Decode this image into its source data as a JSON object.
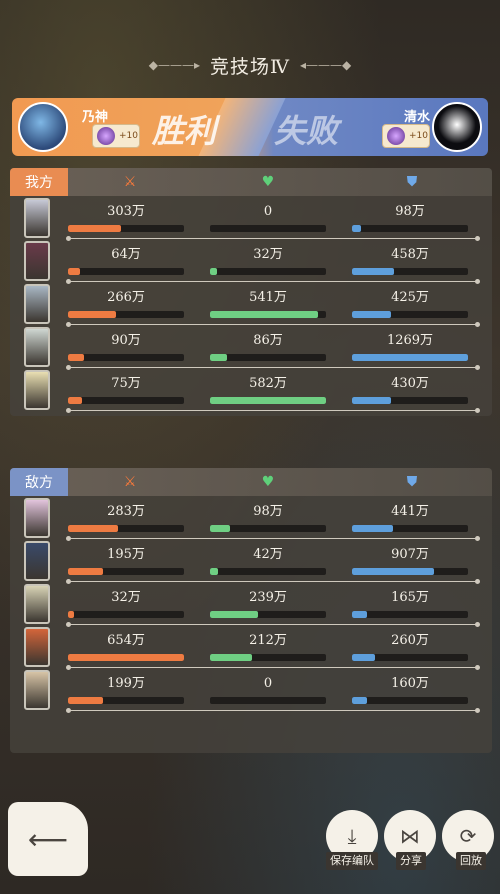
{
  "header": {
    "title": "竞技场Ⅳ"
  },
  "banner": {
    "player_left": "乃神",
    "player_right": "清水",
    "result_win": "胜利",
    "result_lose": "失败",
    "pet_left_level": "+10",
    "pet_right_level": "+10"
  },
  "ours": {
    "label": "我方",
    "rows": [
      {
        "atk": "303万",
        "atk_pct": 0.46,
        "heal": "0",
        "heal_pct": 0.0,
        "def": "98万",
        "def_pct": 0.08
      },
      {
        "atk": "64万",
        "atk_pct": 0.1,
        "heal": "32万",
        "heal_pct": 0.06,
        "def": "458万",
        "def_pct": 0.36
      },
      {
        "atk": "266万",
        "atk_pct": 0.41,
        "heal": "541万",
        "heal_pct": 0.93,
        "def": "425万",
        "def_pct": 0.34
      },
      {
        "atk": "90万",
        "atk_pct": 0.14,
        "heal": "86万",
        "heal_pct": 0.15,
        "def": "1269万",
        "def_pct": 1.0
      },
      {
        "atk": "75万",
        "atk_pct": 0.12,
        "heal": "582万",
        "heal_pct": 1.0,
        "def": "430万",
        "def_pct": 0.34
      }
    ]
  },
  "theirs": {
    "label": "敌方",
    "rows": [
      {
        "atk": "283万",
        "atk_pct": 0.43,
        "heal": "98万",
        "heal_pct": 0.17,
        "def": "441万",
        "def_pct": 0.35
      },
      {
        "atk": "195万",
        "atk_pct": 0.3,
        "heal": "42万",
        "heal_pct": 0.07,
        "def": "907万",
        "def_pct": 0.71
      },
      {
        "atk": "32万",
        "atk_pct": 0.05,
        "heal": "239万",
        "heal_pct": 0.41,
        "def": "165万",
        "def_pct": 0.13
      },
      {
        "atk": "654万",
        "atk_pct": 1.0,
        "heal": "212万",
        "heal_pct": 0.36,
        "def": "260万",
        "def_pct": 0.2
      },
      {
        "atk": "199万",
        "atk_pct": 0.3,
        "heal": "0",
        "heal_pct": 0.0,
        "def": "160万",
        "def_pct": 0.13
      }
    ]
  },
  "portrait_colors": {
    "ours": [
      "#c7c9d6",
      "#6a3a4a",
      "#a9b7c4",
      "#cfd7d2",
      "#e9dfb2"
    ],
    "theirs": [
      "#e2c4dc",
      "#3a4a6a",
      "#d8d3b5",
      "#d4653a",
      "#d7c4a6"
    ]
  },
  "actions": {
    "save_label": "保存编队",
    "share_label": "分享",
    "replay_label": "回放"
  }
}
